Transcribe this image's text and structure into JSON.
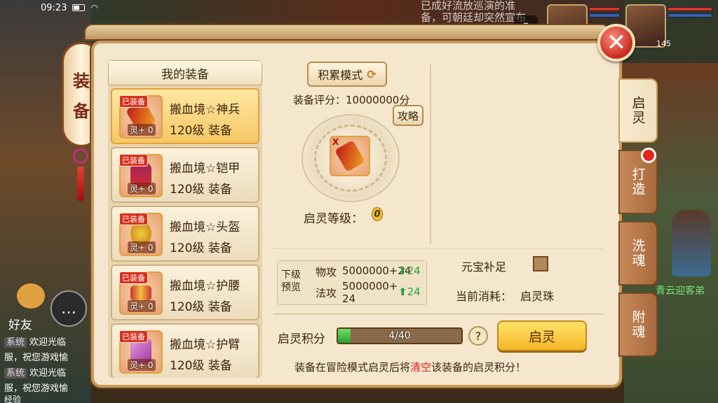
{
  "status_bar": {
    "time": "09:23"
  },
  "top_right": {
    "notice_text": "已成好流放巡演的准备，可朝廷却突然宣布东海流严，这可如何是好",
    "portrait_1_num": "0",
    "portrait_2_level": "145"
  },
  "lantern": {
    "char_1": "装",
    "char_2": "备"
  },
  "chat": {
    "friends_label": "好友",
    "lines": [
      {
        "tag": "系统",
        "text": "欢迎光临"
      },
      {
        "text": "服，祝您游戏愉"
      },
      {
        "tag": "系统",
        "text": "欢迎光临"
      },
      {
        "text": "服，祝您游戏愉"
      }
    ],
    "exp_label": "经验"
  },
  "npc": {
    "name": "青云迎客弟"
  },
  "equip_list": {
    "header": "我的装备",
    "equipped_tag": "已装备",
    "items": [
      {
        "name": "搬血境☆神兵",
        "level": "120级 装备",
        "spirit": "灵+ 0",
        "art": "weapon",
        "selected": true
      },
      {
        "name": "搬血境☆铠甲",
        "level": "120级 装备",
        "spirit": "灵+ 0",
        "art": "armor",
        "selected": false
      },
      {
        "name": "搬血境☆头盔",
        "level": "120级 装备",
        "spirit": "灵+ 0",
        "art": "helmet",
        "selected": false
      },
      {
        "name": "搬血境☆护腰",
        "level": "120级 装备",
        "spirit": "灵+ 0",
        "art": "belt",
        "selected": false
      },
      {
        "name": "搬血境☆护臂",
        "level": "120级 装备",
        "spirit": "灵+ 0",
        "art": "arm",
        "selected": false
      }
    ]
  },
  "detail": {
    "mode_button": "积累模式",
    "score_label": "装备评分：10000000分",
    "guide_button": "攻略",
    "item_x_tag": "X",
    "spirit_level_label": "启灵等级：",
    "spirit_level_value": "0"
  },
  "preview": {
    "title": "下级预览",
    "phys_label": "物攻",
    "phys_value": "5000000+24",
    "phys_up": "24",
    "magic_label": "法攻",
    "magic_value": "5000000+",
    "magic_value_2": "24",
    "magic_up": "24"
  },
  "options": {
    "ingot_label": "元宝补足",
    "cost_label": "当前消耗：",
    "cost_value": "启灵珠"
  },
  "progress": {
    "label": "启灵积分",
    "current": 4,
    "max": 40,
    "text": "4/40"
  },
  "help_glyph": "?",
  "main_button": "启灵",
  "footer": {
    "part_1": "装备在冒险模式启灵后将",
    "warn": "清空",
    "part_2": "该装备的启灵积分！"
  },
  "tabs": [
    {
      "label": "启灵",
      "active": true
    },
    {
      "label": "打造",
      "active": false
    },
    {
      "label": "洗魂",
      "active": false
    },
    {
      "label": "附魂",
      "active": false
    }
  ],
  "close_glyph": "✕",
  "colors": {
    "warn": "#e02020",
    "accent_gold": "#f5b626",
    "progress_green": "#2aa02a"
  }
}
